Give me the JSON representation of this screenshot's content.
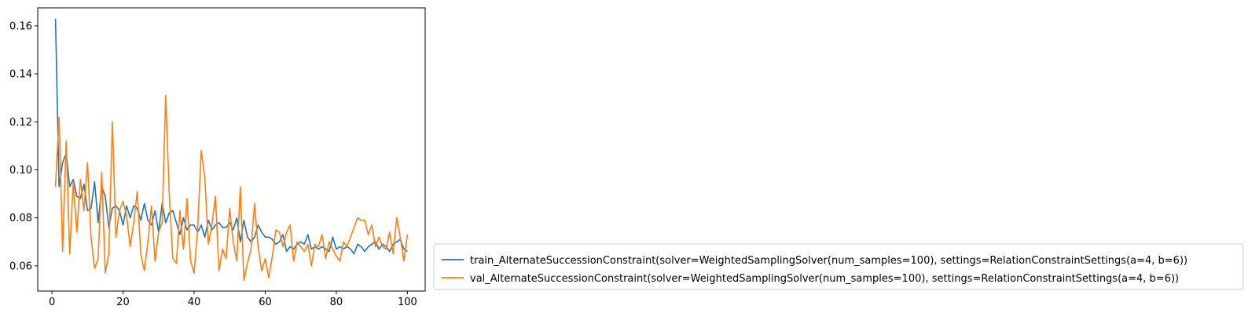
{
  "chart_data": {
    "type": "line",
    "title": "",
    "xlabel": "",
    "ylabel": "",
    "xlim": [
      -4,
      105
    ],
    "ylim": [
      0.0495,
      0.1675
    ],
    "xticks": [
      0,
      20,
      40,
      60,
      80,
      100
    ],
    "yticks": [
      0.06,
      0.08,
      0.1,
      0.12,
      0.14,
      0.16
    ],
    "grid": false,
    "legend_position": "right-bottom",
    "x": [
      1,
      2,
      3,
      4,
      5,
      6,
      7,
      8,
      9,
      10,
      11,
      12,
      13,
      14,
      15,
      16,
      17,
      18,
      19,
      20,
      21,
      22,
      23,
      24,
      25,
      26,
      27,
      28,
      29,
      30,
      31,
      32,
      33,
      34,
      35,
      36,
      37,
      38,
      39,
      40,
      41,
      42,
      43,
      44,
      45,
      46,
      47,
      48,
      49,
      50,
      51,
      52,
      53,
      54,
      55,
      56,
      57,
      58,
      59,
      60,
      61,
      62,
      63,
      64,
      65,
      66,
      67,
      68,
      69,
      70,
      71,
      72,
      73,
      74,
      75,
      76,
      77,
      78,
      79,
      80,
      81,
      82,
      83,
      84,
      85,
      86,
      87,
      88,
      89,
      90,
      91,
      92,
      93,
      94,
      95,
      96,
      97,
      98,
      99,
      100
    ],
    "series": [
      {
        "name": "train_AlternateSuccessionConstraint(solver=WeightedSamplingSolver(num_samples=100), settings=RelationConstraintSettings(a=4, b=6))",
        "color": "#1f77b4",
        "values": [
          0.163,
          0.093,
          0.103,
          0.107,
          0.093,
          0.096,
          0.089,
          0.088,
          0.094,
          0.083,
          0.084,
          0.095,
          0.078,
          0.093,
          0.089,
          0.076,
          0.084,
          0.085,
          0.083,
          0.077,
          0.085,
          0.08,
          0.085,
          0.084,
          0.079,
          0.086,
          0.079,
          0.077,
          0.083,
          0.074,
          0.086,
          0.078,
          0.082,
          0.083,
          0.078,
          0.073,
          0.08,
          0.075,
          0.077,
          0.077,
          0.074,
          0.077,
          0.072,
          0.079,
          0.075,
          0.077,
          0.078,
          0.076,
          0.076,
          0.078,
          0.075,
          0.08,
          0.07,
          0.079,
          0.072,
          0.07,
          0.072,
          0.077,
          0.074,
          0.072,
          0.072,
          0.071,
          0.069,
          0.07,
          0.073,
          0.066,
          0.068,
          0.067,
          0.069,
          0.07,
          0.069,
          0.073,
          0.067,
          0.068,
          0.067,
          0.068,
          0.067,
          0.066,
          0.072,
          0.067,
          0.068,
          0.067,
          0.068,
          0.067,
          0.065,
          0.069,
          0.068,
          0.066,
          0.068,
          0.069,
          0.07,
          0.067,
          0.069,
          0.068,
          0.066,
          0.069,
          0.07,
          0.071,
          0.067,
          0.066
        ]
      },
      {
        "name": "val_AlternateSuccessionConstraint(solver=WeightedSamplingSolver(num_samples=100), settings=RelationConstraintSettings(a=4, b=6))",
        "color": "#ff7f0e",
        "values": [
          0.093,
          0.122,
          0.066,
          0.112,
          0.065,
          0.095,
          0.074,
          0.096,
          0.083,
          0.103,
          0.072,
          0.059,
          0.063,
          0.099,
          0.057,
          0.065,
          0.12,
          0.072,
          0.083,
          0.087,
          0.081,
          0.068,
          0.078,
          0.091,
          0.065,
          0.058,
          0.07,
          0.085,
          0.062,
          0.074,
          0.078,
          0.131,
          0.09,
          0.063,
          0.061,
          0.083,
          0.067,
          0.088,
          0.062,
          0.057,
          0.076,
          0.108,
          0.097,
          0.069,
          0.077,
          0.089,
          0.058,
          0.067,
          0.063,
          0.084,
          0.07,
          0.062,
          0.093,
          0.054,
          0.061,
          0.067,
          0.086,
          0.068,
          0.058,
          0.063,
          0.055,
          0.064,
          0.075,
          0.074,
          0.068,
          0.074,
          0.077,
          0.062,
          0.07,
          0.068,
          0.066,
          0.069,
          0.06,
          0.069,
          0.068,
          0.073,
          0.063,
          0.07,
          0.067,
          0.064,
          0.062,
          0.07,
          0.068,
          0.072,
          0.076,
          0.08,
          0.079,
          0.079,
          0.073,
          0.077,
          0.068,
          0.072,
          0.068,
          0.067,
          0.074,
          0.065,
          0.08,
          0.072,
          0.062,
          0.073
        ]
      }
    ]
  }
}
